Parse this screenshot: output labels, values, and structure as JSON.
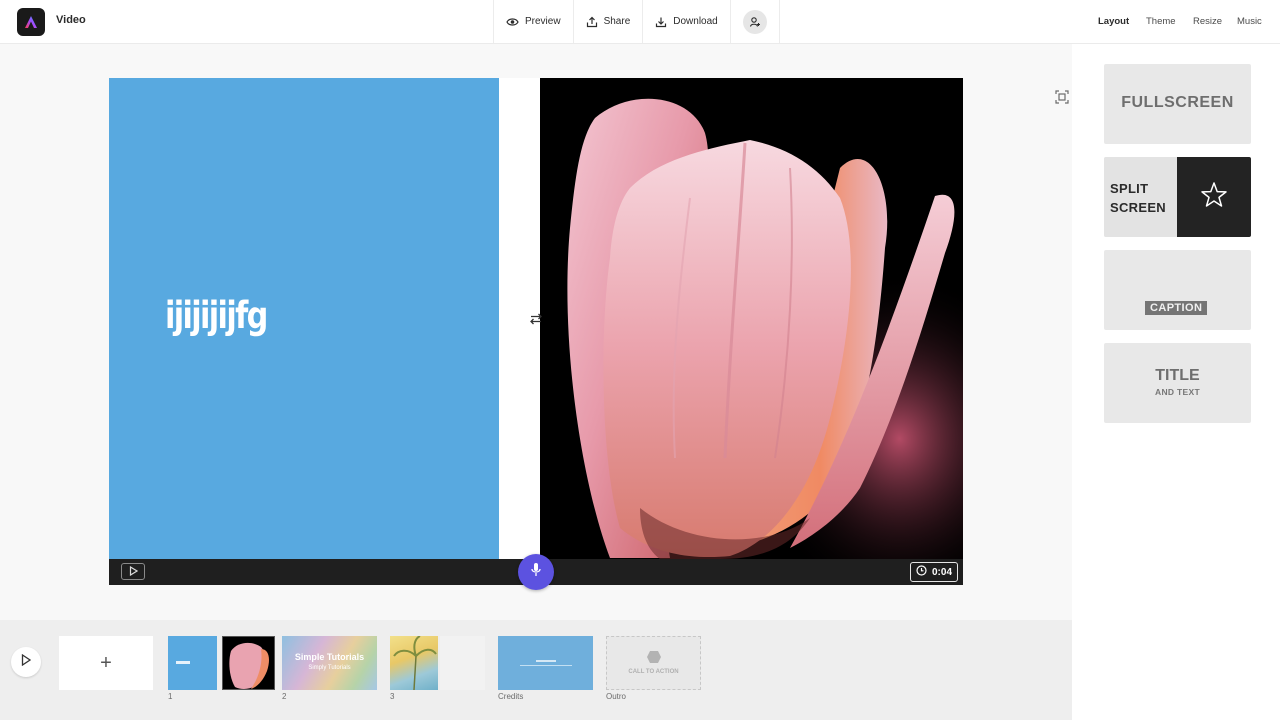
{
  "header": {
    "title": "Video",
    "actions": [
      {
        "label": "Preview",
        "icon": "eye-icon"
      },
      {
        "label": "Share",
        "icon": "share-icon"
      },
      {
        "label": "Download",
        "icon": "download-icon"
      }
    ],
    "invite_icon": "add-person-icon",
    "tabs": [
      "Layout",
      "Theme",
      "Resize",
      "Music"
    ],
    "active_tab": "Layout"
  },
  "slide": {
    "text": "ijijijijfg",
    "left_color": "#58a9e0",
    "image": "pink-tulip-photo"
  },
  "player": {
    "duration": "0:04"
  },
  "layouts": {
    "fullscreen": "FULLSCREEN",
    "split_line1": "SPLIT",
    "split_line2": "SCREEN",
    "caption": "CAPTION",
    "title_big": "TITLE",
    "title_small": "AND TEXT",
    "selected": "split-screen"
  },
  "timeline": {
    "add_label": "+",
    "thumbs": [
      {
        "label": "1",
        "kind": "blue-text-slide"
      },
      {
        "label": "2",
        "kind": "simply-tutorials-slide",
        "title": "Simple Tutorials",
        "subtitle": "Simply Tutorials"
      },
      {
        "label": "3",
        "kind": "palm-slide"
      },
      {
        "label": "Credits",
        "kind": "credits-slide"
      },
      {
        "label": "Outro",
        "kind": "outro-slide",
        "text": "CALL TO ACTION"
      }
    ]
  },
  "colors": {
    "accent": "#5c52e0",
    "slide_blue": "#58a9e0",
    "selected_dark": "#232323"
  }
}
